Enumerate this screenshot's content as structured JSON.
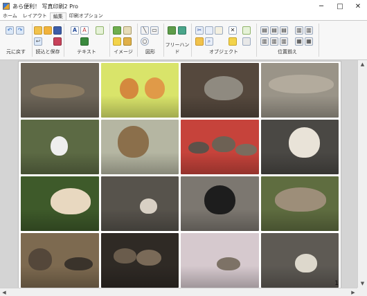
{
  "window": {
    "title": "あら便利！ 写真印刷2 Pro",
    "controls": {
      "minimize": "─",
      "maximize": "□",
      "close": "✕"
    }
  },
  "tabs": [
    {
      "label": "ホーム",
      "active": false
    },
    {
      "label": "レイアウト",
      "active": false
    },
    {
      "label": "編集",
      "active": true
    },
    {
      "label": "印刷オプション",
      "active": false
    }
  ],
  "ribbon": {
    "groups": [
      {
        "label": "元に戻す",
        "icons": [
          "undo-icon",
          "redo-icon"
        ]
      },
      {
        "label": "読込と保存",
        "icons": [
          "open-folder-icon",
          "folder-add-icon",
          "save-icon",
          "back-icon",
          "save-as-icon"
        ]
      },
      {
        "label": "テキスト",
        "icons": [
          "text-icon",
          "text-style-icon",
          "text-box-icon",
          "text-edit-icon"
        ]
      },
      {
        "label": "イメージ",
        "icons": [
          "image-icon",
          "image-edit-icon",
          "pencil-icon",
          "image-add-icon"
        ]
      },
      {
        "label": "図形",
        "icons": [
          "line-icon",
          "shape-icon",
          "circle-icon"
        ]
      },
      {
        "label": "フリーハンド",
        "icons": [
          "freehand-icon",
          "eraser-icon"
        ]
      },
      {
        "label": "オブジェクト",
        "icons": [
          "scissors-icon",
          "copy-icon",
          "paste-icon",
          "delete-icon",
          "folder-icon",
          "search-icon",
          "send-back-icon",
          "bring-front-icon"
        ]
      },
      {
        "label": "位置揃え",
        "icons": [
          "align-left-icon",
          "align-center-icon",
          "align-right-icon",
          "align-top-icon",
          "align-middle-icon",
          "align-bottom-icon",
          "distribute-h-icon",
          "distribute-v-icon"
        ]
      }
    ]
  },
  "document": {
    "page_number": "1",
    "photos": [
      {
        "name": "photo-tabby-lying",
        "bg": "#6d6558",
        "cats": [
          {
            "c": "#8a7a62",
            "l": 12,
            "t": 38,
            "w": 70,
            "h": 26
          }
        ]
      },
      {
        "name": "photo-two-kittens",
        "bg": "#d9e46a",
        "cats": [
          {
            "c": "#d4893e",
            "l": 24,
            "t": 28,
            "w": 24,
            "h": 38
          },
          {
            "c": "#e09a48",
            "l": 56,
            "t": 26,
            "w": 26,
            "h": 40
          }
        ]
      },
      {
        "name": "photo-tabby-resting",
        "bg": "#55483d",
        "cats": [
          {
            "c": "#8f8a80",
            "l": 30,
            "t": 24,
            "w": 50,
            "h": 44
          }
        ]
      },
      {
        "name": "photo-cat-stretching",
        "bg": "#9a9488",
        "cats": [
          {
            "c": "#b3ab9d",
            "l": 10,
            "t": 22,
            "w": 84,
            "h": 34
          }
        ]
      },
      {
        "name": "photo-white-cat-road",
        "bg": "#5c6a44",
        "cats": [
          {
            "c": "#eeeeee",
            "l": 38,
            "t": 30,
            "w": 22,
            "h": 36
          }
        ]
      },
      {
        "name": "photo-cat-plants",
        "bg": "#b5b6a2",
        "cats": [
          {
            "c": "#8b6f4b",
            "l": 22,
            "t": 12,
            "w": 40,
            "h": 58
          }
        ]
      },
      {
        "name": "photo-kittens-group",
        "bg": "#c6433b",
        "cats": [
          {
            "c": "#5d5149",
            "l": 10,
            "t": 40,
            "w": 26,
            "h": 22
          },
          {
            "c": "#6d6154",
            "l": 40,
            "t": 30,
            "w": 30,
            "h": 30
          },
          {
            "c": "#7a6c5e",
            "l": 70,
            "t": 44,
            "w": 28,
            "h": 22
          }
        ]
      },
      {
        "name": "photo-calico-sitting",
        "bg": "#4a4844",
        "cats": [
          {
            "c": "#e9e3d8",
            "l": 36,
            "t": 14,
            "w": 40,
            "h": 56
          }
        ]
      },
      {
        "name": "photo-cat-in-grass",
        "bg": "#3e5a2a",
        "cats": [
          {
            "c": "#e8d8c0",
            "l": 38,
            "t": 22,
            "w": 52,
            "h": 48
          }
        ]
      },
      {
        "name": "photo-cat-on-steps",
        "bg": "#57534c",
        "cats": [
          {
            "c": "#d8d0c4",
            "l": 50,
            "t": 40,
            "w": 22,
            "h": 28
          }
        ]
      },
      {
        "name": "photo-black-white-cat",
        "bg": "#7c7770",
        "cats": [
          {
            "c": "#1d1d1d",
            "l": 30,
            "t": 16,
            "w": 40,
            "h": 54
          }
        ]
      },
      {
        "name": "photo-tabby-on-wall",
        "bg": "#5f6d40",
        "cats": [
          {
            "c": "#9d8e79",
            "l": 18,
            "t": 20,
            "w": 66,
            "h": 44
          }
        ]
      },
      {
        "name": "photo-cats-outdoors",
        "bg": "#7d6a50",
        "cats": [
          {
            "c": "#54473a",
            "l": 10,
            "t": 28,
            "w": 30,
            "h": 40
          },
          {
            "c": "#3a332b",
            "l": 56,
            "t": 44,
            "w": 36,
            "h": 24
          }
        ]
      },
      {
        "name": "photo-kittens-box",
        "bg": "#2f2a25",
        "cats": [
          {
            "c": "#6a5c4c",
            "l": 16,
            "t": 28,
            "w": 30,
            "h": 28
          },
          {
            "c": "#7a6a58",
            "l": 46,
            "t": 30,
            "w": 32,
            "h": 30
          }
        ]
      },
      {
        "name": "photo-cat-blossoms",
        "bg": "#d6c9ce",
        "cats": [
          {
            "c": "#7d7266",
            "l": 46,
            "t": 44,
            "w": 30,
            "h": 24
          }
        ]
      },
      {
        "name": "photo-cat-on-bench",
        "bg": "#5e5a54",
        "cats": [
          {
            "c": "#ddd8cc",
            "l": 44,
            "t": 38,
            "w": 28,
            "h": 34
          }
        ]
      }
    ]
  },
  "scrollbars": {
    "up": "▲",
    "down": "▼",
    "left": "◀",
    "right": "▶"
  }
}
